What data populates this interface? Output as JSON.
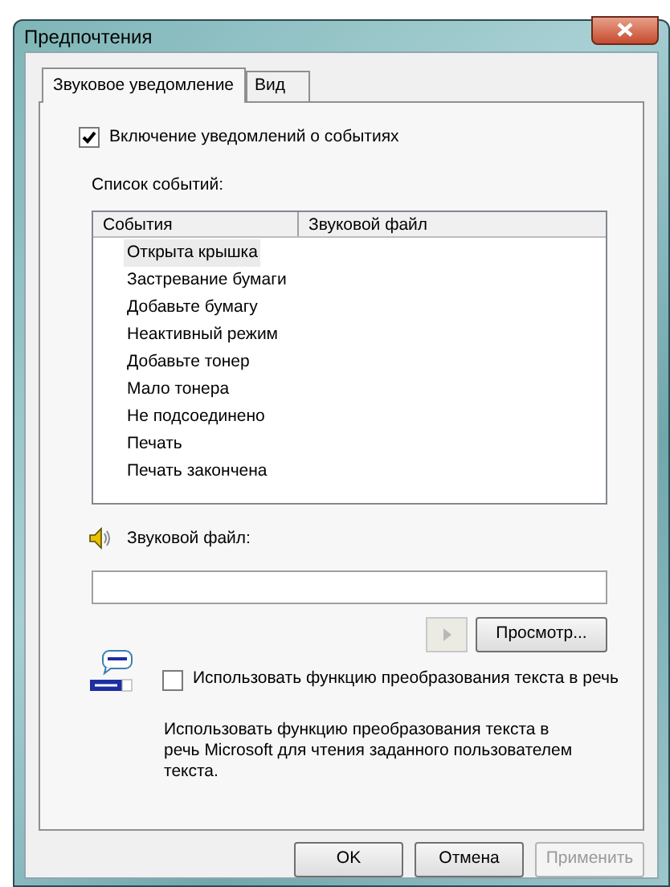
{
  "window": {
    "title": "Предпочтения"
  },
  "tabs": [
    {
      "label": "Звуковое уведомление",
      "selected": true
    },
    {
      "label": "Вид",
      "selected": false
    }
  ],
  "enable_notifications": {
    "label": "Включение уведомлений о событиях",
    "checked": true
  },
  "events": {
    "label": "Список событий:",
    "columns": [
      "События",
      "Звуковой файл"
    ],
    "rows": [
      {
        "event": "Открыта крышка",
        "selected": true
      },
      {
        "event": "Застревание бумаги",
        "selected": false
      },
      {
        "event": "Добавьте бумагу",
        "selected": false
      },
      {
        "event": "Неактивный режим",
        "selected": false
      },
      {
        "event": "Добавьте тонер",
        "selected": false
      },
      {
        "event": "Мало тонера",
        "selected": false
      },
      {
        "event": "Не подсоединено",
        "selected": false
      },
      {
        "event": "Печать",
        "selected": false
      },
      {
        "event": "Печать закончена",
        "selected": false
      }
    ]
  },
  "sound_file": {
    "label": "Звуковой файл:",
    "play_disabled": true,
    "browse": "Просмотр..."
  },
  "tts": {
    "label": "Использовать функцию преобразования текста в речь",
    "checked": false,
    "description": "Использовать функцию преобразования текста в речь Microsoft для чтения заданного пользователем текста."
  },
  "buttons": [
    {
      "label": "OK",
      "disabled": false
    },
    {
      "label": "Отмена",
      "disabled": false
    },
    {
      "label": "Применить",
      "disabled": true
    }
  ]
}
